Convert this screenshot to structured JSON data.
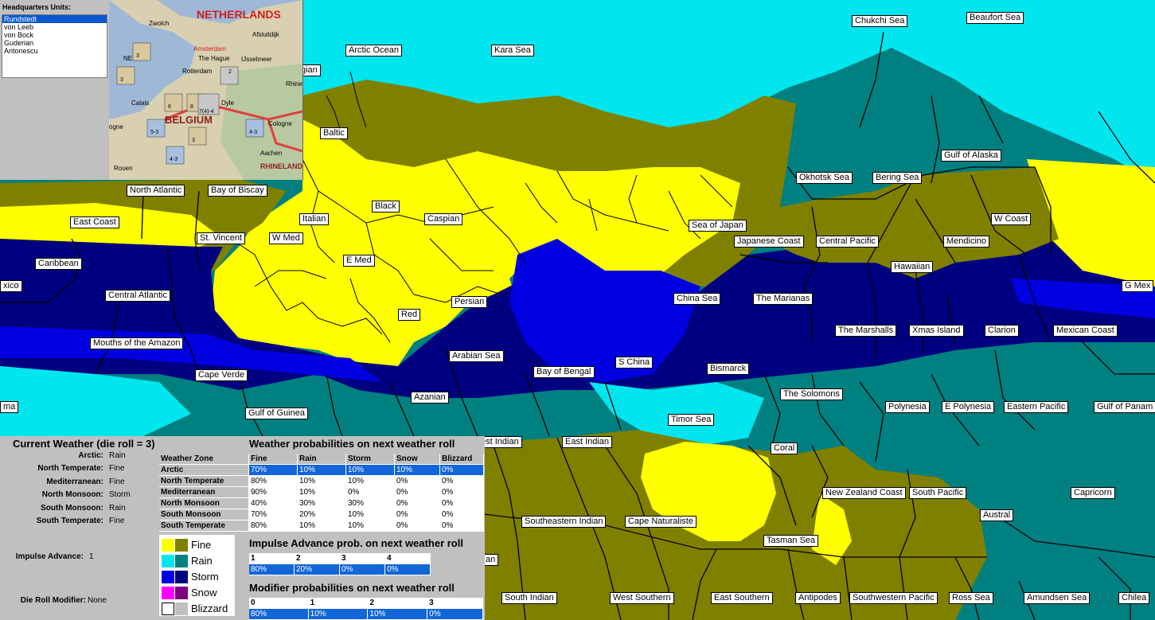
{
  "colors": {
    "fine": "#ffff00",
    "rain": "#00e5ee",
    "storm": "#000080",
    "storm_bright": "#0000e0",
    "snow": "#ff00ff",
    "blizzard": "#ffffff",
    "land_rain": "#808000",
    "sea_rain": "#008080",
    "sea_snow": "#800080",
    "land_blizzard": "#c0c0c0",
    "selection": "#1266d8"
  },
  "hq": {
    "title": "Headquarters Units:",
    "units": [
      "Rundstedt",
      "von Leeb",
      "von Bock",
      "Guderian",
      "Antonescu"
    ],
    "selected_index": 0
  },
  "minimap": {
    "country_netherlands": "NETHERLANDS",
    "country_belgium": "BELGIUM",
    "country_rhineland": "RHINELAND",
    "cities": [
      "Zwolch",
      "Afsluitdijk",
      "Amsterdam",
      "The Hague",
      "IJsselmeer",
      "Rotterdam",
      "Calais",
      "Brogne",
      "Cologne",
      "Aachen",
      "Rouen",
      "Rhine",
      "Dyle",
      "NE?"
    ],
    "counters": [
      "5-3",
      "4-3",
      "4-3",
      "3",
      "3",
      "3",
      "6",
      "8",
      "7(4)-4",
      "2"
    ]
  },
  "sea_labels": [
    "Chukchi Sea",
    "Beaufort Sea",
    "Arctic Ocean",
    "Kara Sea",
    "gian",
    "Baltic",
    "Gulf of Alaska",
    "Okhotsk Sea",
    "Bering Sea",
    "North Atlantic",
    "Bay of Biscay",
    "Black",
    "Caspian",
    "Italian",
    "East Coast",
    "St. Vincent",
    "W Med",
    "Sea of Japan",
    "W Coast",
    "Japanese Coast",
    "Central Pacific",
    "Mendicino",
    "Caribbean",
    "E Med",
    "Hawaiian",
    "G Mex",
    "xico",
    "Central Atlantic",
    "Persian",
    "China Sea",
    "The Marianas",
    "Red",
    "The Marshalls",
    "Xmas Island",
    "Clarion",
    "Mexican Coast",
    "Mouths of the Amazon",
    "Arabian Sea",
    "S China",
    "Bay of Bengal",
    "Bismarck",
    "Cape Verde",
    "The Solomons",
    "Azanian",
    "ma",
    "Polynesia",
    "E Polynesia",
    "Eastern Pacific",
    "Gulf of Panam",
    "Gulf of Guinea",
    "Timor Sea",
    "est Indian",
    "East Indian",
    "Coral",
    "New Zealand Coast",
    "South Pacific",
    "Capricorn",
    "Austral",
    "Southeastern Indian",
    "Cape Naturaliste",
    "Tasman Sea",
    "an",
    "South Indian",
    "West Southern",
    "East Southern",
    "Antipodes",
    "Southwestern Pacific",
    "Ross Sea",
    "Amundsen Sea",
    "Chilea"
  ],
  "weather": {
    "current_title": "Current Weather (die roll = 3)",
    "zones": [
      {
        "name": "Arctic:",
        "value": "Rain"
      },
      {
        "name": "North Temperate:",
        "value": "Fine"
      },
      {
        "name": "Mediterranean:",
        "value": "Fine"
      },
      {
        "name": "North Monsoon:",
        "value": "Storm"
      },
      {
        "name": "South Monsoon:",
        "value": "Rain"
      },
      {
        "name": "South Temperate:",
        "value": "Fine"
      }
    ],
    "impulse_label": "Impulse Advance:",
    "impulse_value": "1",
    "die_mod_label": "Die Roll Modifier:",
    "die_mod_value": "None",
    "prob_title": "Weather probabilities on next weather roll",
    "prob_headers": [
      "Weather Zone",
      "Fine",
      "Rain",
      "Storm",
      "Snow",
      "Blizzard"
    ],
    "prob_rows": [
      [
        "Arctic",
        "70%",
        "10%",
        "10%",
        "10%",
        "0%"
      ],
      [
        "North Temperate",
        "80%",
        "10%",
        "10%",
        "0%",
        "0%"
      ],
      [
        "Mediterranean",
        "90%",
        "10%",
        "0%",
        "0%",
        "0%"
      ],
      [
        "North Monsoon",
        "40%",
        "30%",
        "30%",
        "0%",
        "0%"
      ],
      [
        "South Monsoon",
        "70%",
        "20%",
        "10%",
        "0%",
        "0%"
      ],
      [
        "South Temperate",
        "80%",
        "10%",
        "10%",
        "0%",
        "0%"
      ]
    ],
    "prob_selected": 0,
    "legend": [
      "Fine",
      "Rain",
      "Storm",
      "Snow",
      "Blizzard"
    ],
    "impulse_prob_title": "Impulse Advance prob. on next weather roll",
    "impulse_headers": [
      "1",
      "2",
      "3",
      "4"
    ],
    "impulse_values": [
      "80%",
      "20%",
      "0%",
      "0%"
    ],
    "modifier_prob_title": "Modifier probabilities on next weather roll",
    "modifier_headers": [
      "0",
      "1",
      "2",
      "3"
    ],
    "modifier_values": [
      "80%",
      "10%",
      "10%",
      "0%"
    ]
  }
}
